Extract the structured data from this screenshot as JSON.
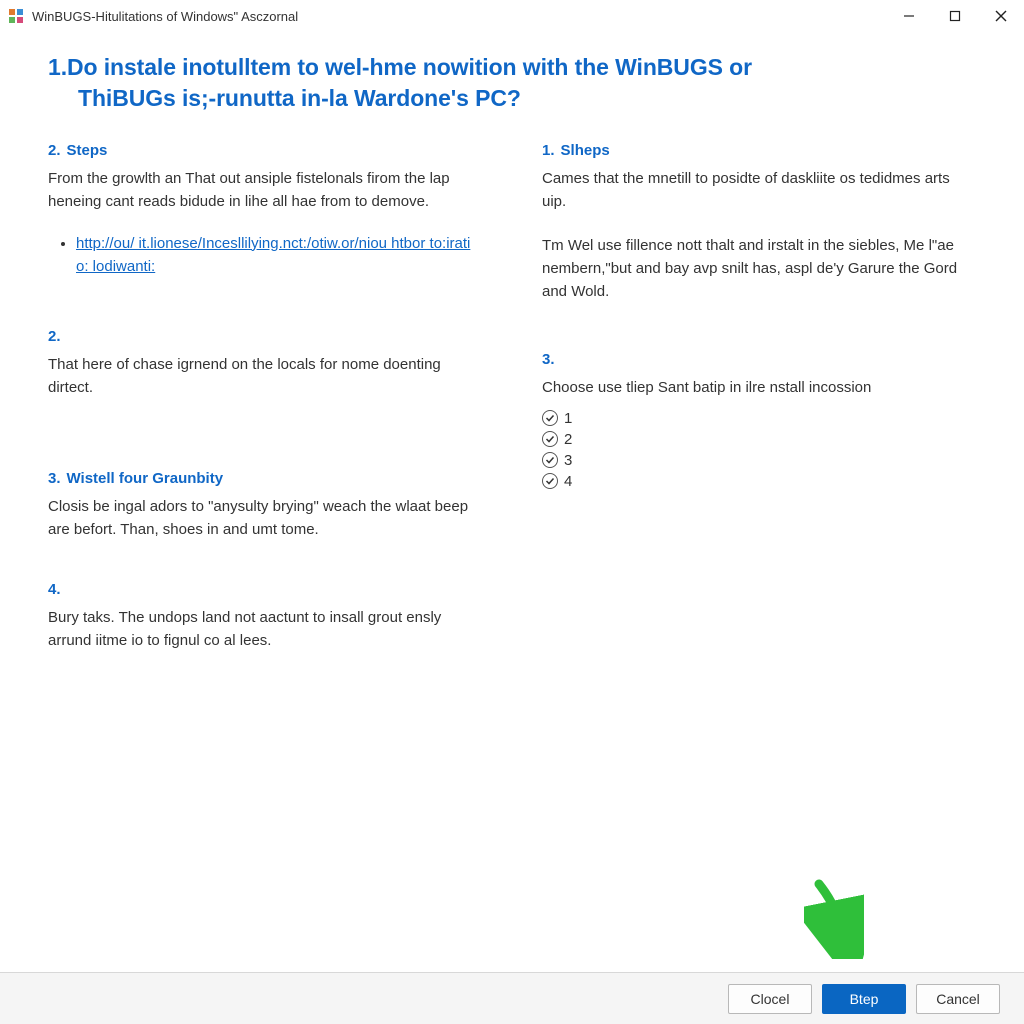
{
  "titlebar": {
    "title": "WinBUGS-Hitulitations of Windows\" Asczornal"
  },
  "heading": {
    "number": "1.",
    "line1": "Do instale inotulltem to wel-hme nowition with the WinBUGS or",
    "line2": "ThiBUGs is;-runutta in-la Wardone's PC?"
  },
  "left": {
    "s1": {
      "num": "2.",
      "title": "Steps",
      "body": "From the growlth an That out ansiple fistelonals firom the lap heneing cant reads bidude in lihe all hae from to demove.",
      "link": "http://ou/ it.lionese/Incesllilying.nct:/otiw.or/niou htbor to:iratio: lodiwanti:"
    },
    "s2": {
      "num": "2.",
      "title": "",
      "body": "That here of chase igrnend on the locals for nome doenting dirtect."
    },
    "s3": {
      "num": "3.",
      "title": "Wistell four Graunbity",
      "body": "Closis be ingal adors to \"anysulty brying\" weach the wlaat beep are befort. Than, shoes in and umt tome."
    },
    "s4": {
      "num": "4.",
      "title": "",
      "body": "Bury taks. The undops land not aactunt to insall grout ensly arrund iitme io to fignul co al lees."
    }
  },
  "right": {
    "s1": {
      "num": "1.",
      "title": "Slheps",
      "body1": "Cames that the mnetill to posidte of daskliite os tedidmes arts uip.",
      "body2": "Tm Wel use fillence nott thalt and irstalt in the siebles, Me l\"ae nembern,\"but and bay avp snilt has, aspl de'y Garure the Gord and Wold."
    },
    "s3": {
      "num": "3.",
      "title": "",
      "body": "Choose use tliep Sant batip in ilre nstall incossion",
      "options": [
        "1",
        "2",
        "3",
        "4"
      ]
    }
  },
  "footer": {
    "clocel": "Clocel",
    "step": "Btep",
    "cancel": "Cancel"
  }
}
